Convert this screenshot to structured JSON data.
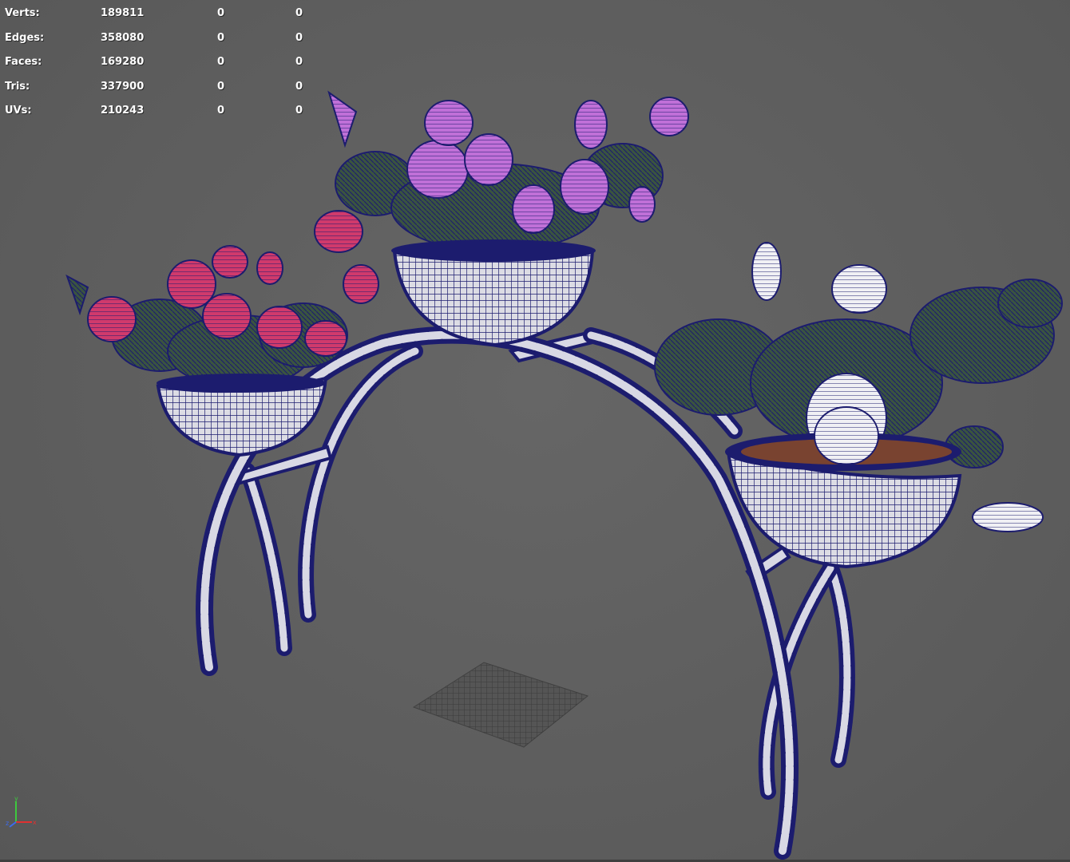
{
  "stats": {
    "rows": [
      {
        "label": "Verts:",
        "total": "189811",
        "selected": "0",
        "component": "0"
      },
      {
        "label": "Edges:",
        "total": "358080",
        "selected": "0",
        "component": "0"
      },
      {
        "label": "Faces:",
        "total": "169280",
        "selected": "0",
        "component": "0"
      },
      {
        "label": "Tris:",
        "total": "337900",
        "selected": "0",
        "component": "0"
      },
      {
        "label": "UVs:",
        "total": "210243",
        "selected": "0",
        "component": "0"
      }
    ]
  },
  "axis_gizmo": {
    "y": "y",
    "z": "z",
    "x": "x"
  },
  "colors": {
    "background": "#5f5f5f",
    "wire": "#1c1c6e",
    "metal": "#d8d8e4",
    "leaf": "#3d5540",
    "flower_pink": "#c03060",
    "flower_violet": "#b060c8",
    "flower_white": "#e8e8ee",
    "soil": "#a05a2a"
  }
}
